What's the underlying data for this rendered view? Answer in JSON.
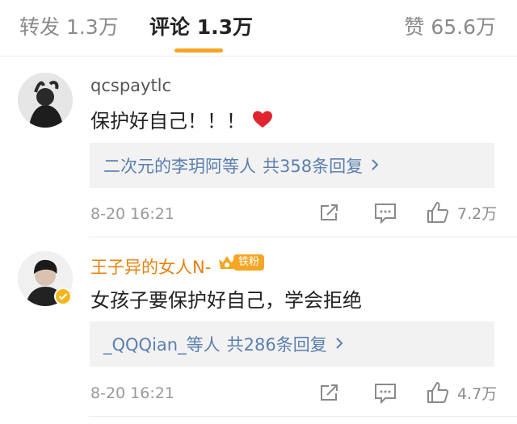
{
  "tabs": {
    "repost": "转发 1.3万",
    "comments": "评论 1.3万",
    "likes": "赞 65.6万",
    "accent_color": "#f5a623"
  },
  "comments": [
    {
      "username": "qcspaytlc",
      "text": "保护好自己！！！",
      "emoji": "red-heart-icon",
      "replies_who": "二次元的李玥阿等人",
      "replies_total": "共358条回复",
      "time": "8-20 16:21",
      "likes": "7.2万"
    },
    {
      "username": "王子异的女人N-",
      "fan_badge": "铁粉",
      "verified": true,
      "text": "女孩子要保护好自己，学会拒绝",
      "replies_who": "_QQQian_等人",
      "replies_total": "共286条回复",
      "time": "8-20 16:21",
      "likes": "4.7万"
    }
  ],
  "colors": {
    "link": "#5b7fb0",
    "gold_username": "#e8810c",
    "heart": "#e0242f",
    "reply_bg": "#f2f2f2"
  }
}
